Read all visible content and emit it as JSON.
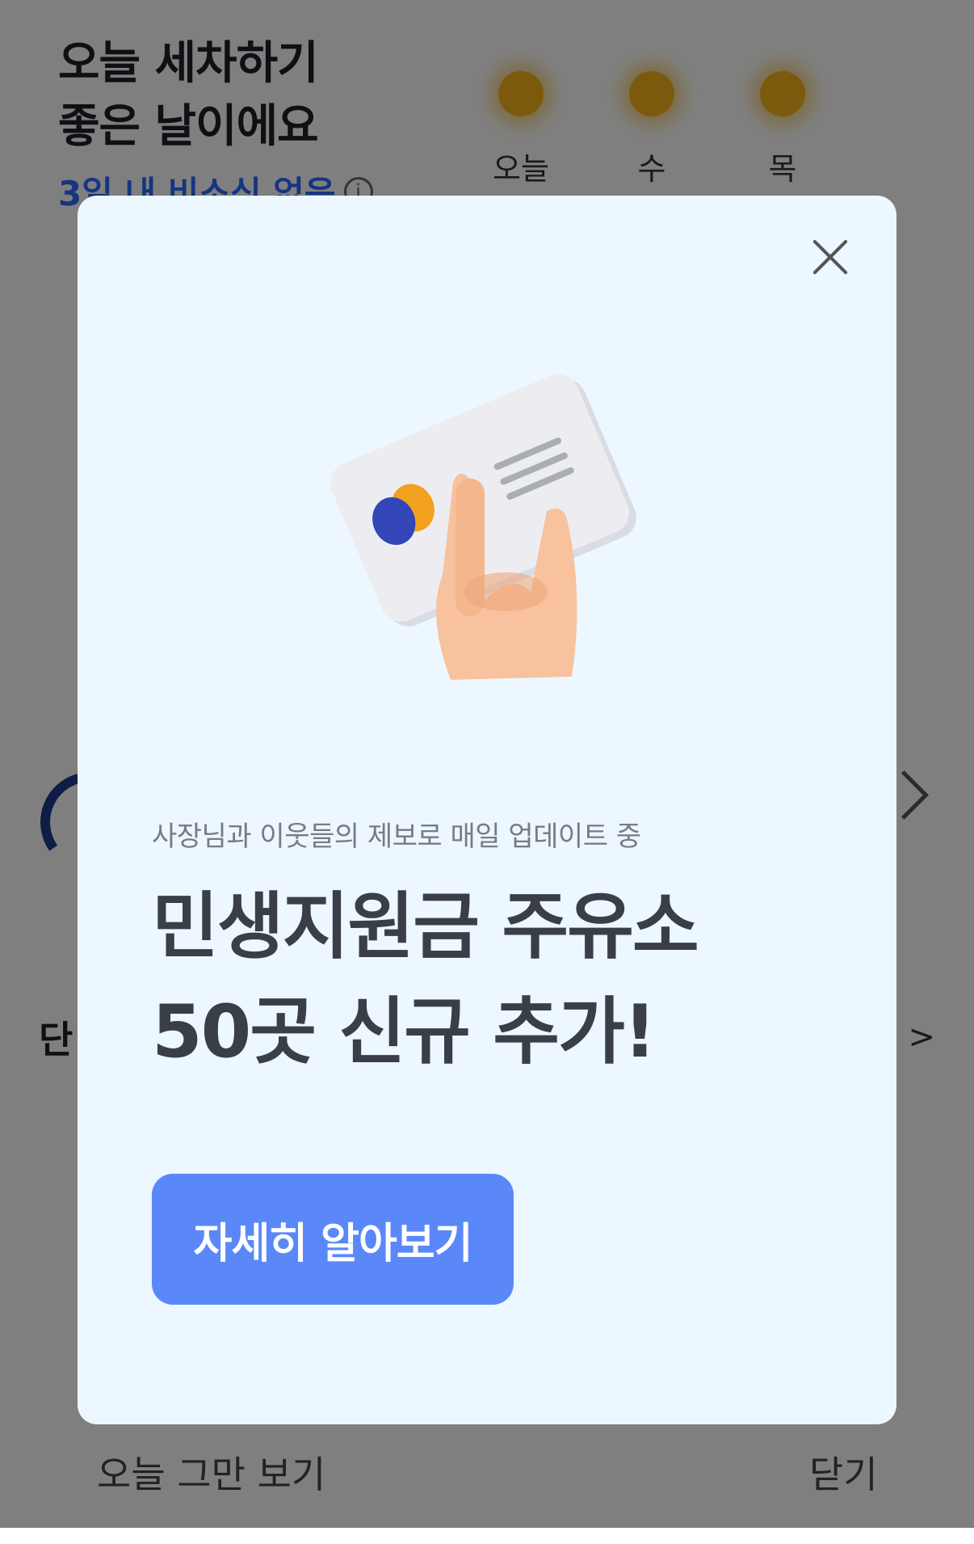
{
  "header": {
    "headline_line1": "오늘 세차하기",
    "headline_line2": "좋은 날이에요",
    "rain_note": "3일 내 비소식 없음"
  },
  "forecast": [
    {
      "label": "오늘",
      "icon": "sun-icon"
    },
    {
      "label": "수",
      "icon": "sun-icon"
    },
    {
      "label": "목",
      "icon": "sun-icon"
    }
  ],
  "section": {
    "title": "단",
    "more": "기 >"
  },
  "footer": {
    "dismiss_today": "오늘 그만 보기",
    "close": "닫기"
  },
  "modal": {
    "subtitle": "사장님과 이웃들의 제보로 매일 업데이트 중",
    "title_line1": "민생지원금 주유소",
    "title_line2": "50곳 신규 추가!",
    "cta_label": "자세히 알아보기",
    "illustration_icon": "hand-holding-card-icon"
  },
  "colors": {
    "accent": "#5a88f9",
    "modal_bg": "#edf7ff",
    "note_blue": "#2b6bff",
    "sun": "#f6b41a"
  }
}
